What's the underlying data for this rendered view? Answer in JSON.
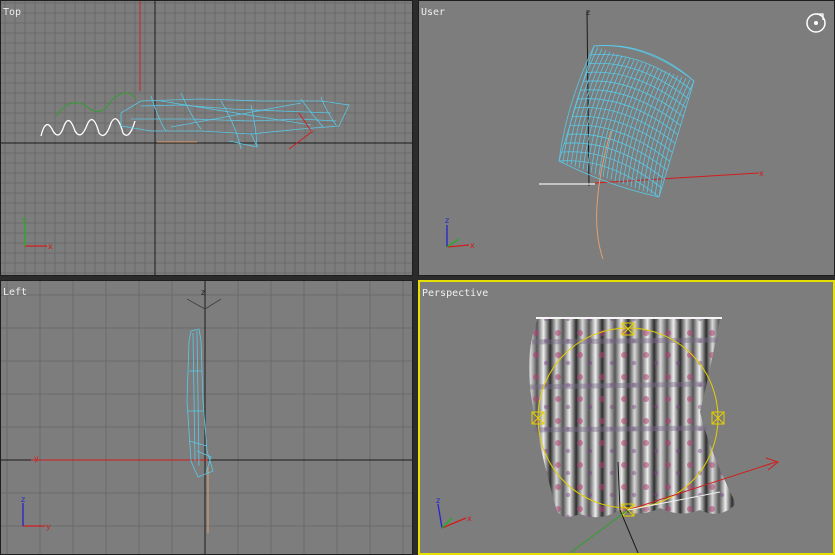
{
  "viewports": {
    "top": {
      "label": "Top"
    },
    "user": {
      "label": "User"
    },
    "left": {
      "label": "Left"
    },
    "perspective": {
      "label": "Perspective",
      "active": true
    }
  },
  "axes": {
    "x": "x",
    "y": "y",
    "z": "z"
  },
  "colors": {
    "viewport_bg": "#7d7d7d",
    "grid_minor": "#6a6a6a",
    "grid_major": "#1a1a1a",
    "mesh": "#59c8e6",
    "axis_x": "#d21c1c",
    "axis_y": "#1fb01f",
    "axis_z": "#2424d0",
    "active_border": "#e6e000"
  },
  "icons": {
    "orbit": "orbit-icon"
  }
}
